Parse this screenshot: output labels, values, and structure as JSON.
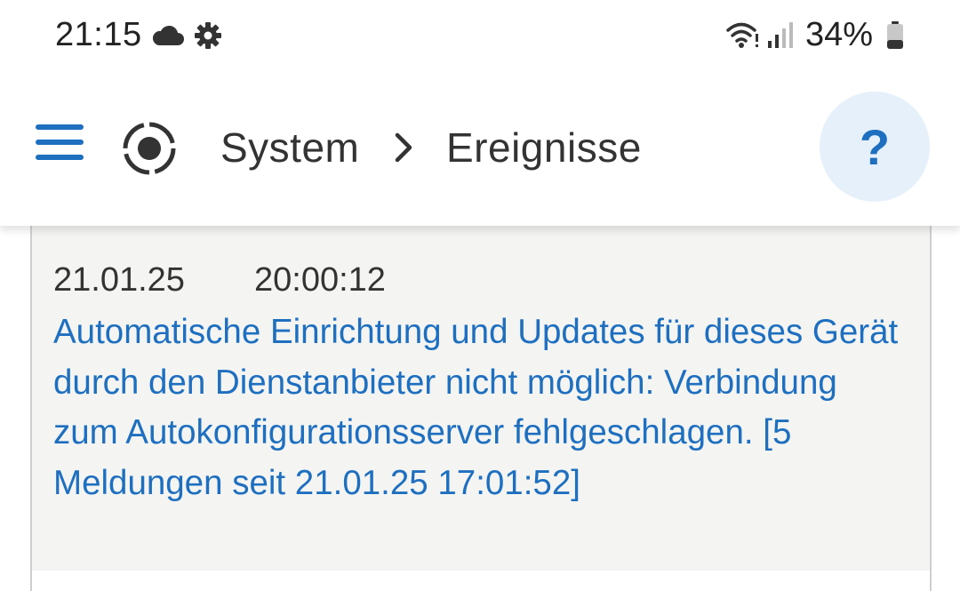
{
  "status_bar": {
    "time": "21:15",
    "battery_percent": "34%",
    "battery_level": 0.34,
    "icons": [
      "cloud-icon",
      "gear-icon",
      "wifi-icon",
      "signal-icon",
      "battery-icon"
    ]
  },
  "header": {
    "breadcrumb": [
      "System",
      "Ereignisse"
    ],
    "help_label": "?",
    "colors": {
      "accent": "#1e6fbf",
      "help_bg": "#e6f0fb"
    }
  },
  "events": [
    {
      "date": "21.01.25",
      "time": "20:00:12",
      "message": "Automatische Einrichtung und Updates für dieses Gerät durch den Dienstanbieter nicht möglich: Verbindung zum Autokonfigurationsserver fehlgeschlagen. [5 Meldungen seit 21.01.25 17:01:52]"
    }
  ]
}
